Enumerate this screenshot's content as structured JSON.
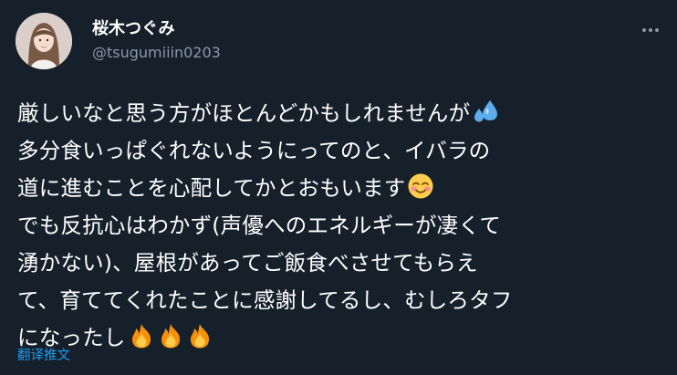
{
  "user": {
    "display_name": "桜木つぐみ",
    "handle": "@tsugumiiin0203"
  },
  "tweet": {
    "lines": [
      "厳しいなと思う方がほとんどかもしれませんが",
      "多分食いっぱぐれないようにってのと、イバラの",
      "道に進むことを心配してかとおもいます",
      "でも反抗心はわかず(声優へのエネルギーが凄くて",
      "湧かない)、屋根があってご飯食べさせてもらえ",
      "て、育ててくれたことに感謝してるし、むしろタフ",
      "になったし"
    ],
    "emojis": [
      "sweat-droplets-emoji",
      "smiling-face-emoji",
      "fire-emoji",
      "fire-emoji",
      "fire-emoji"
    ]
  },
  "actions": {
    "translate_label": "翻译推文"
  },
  "colors": {
    "background": "#15202b",
    "text": "#ffffff",
    "secondary": "#8b98a5",
    "link": "#1d9bf0"
  }
}
